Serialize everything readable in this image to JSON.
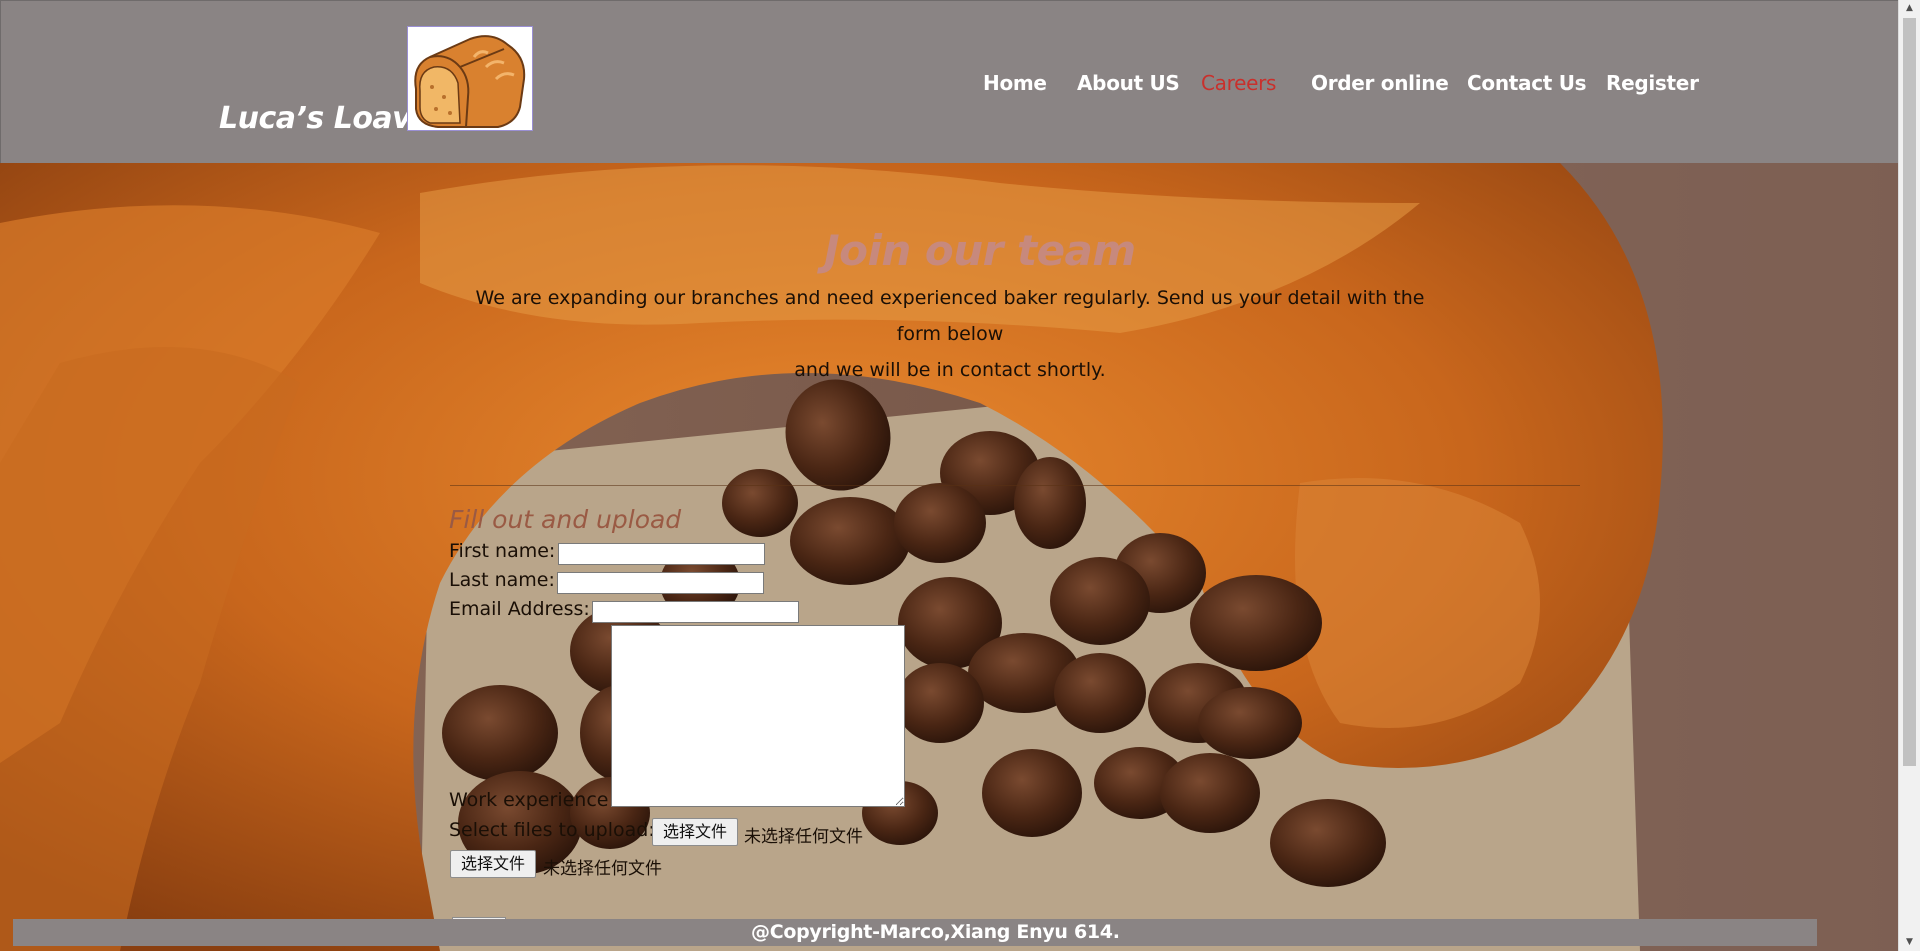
{
  "header": {
    "brand": "Luca’s Loaves",
    "logo_icon": "bread-loaf-icon",
    "nav": [
      {
        "label": "Home",
        "active": false
      },
      {
        "label": "About US",
        "active": false
      },
      {
        "label": "Careers",
        "active": true
      },
      {
        "label": "Order online",
        "active": false
      },
      {
        "label": "Contact Us",
        "active": false
      },
      {
        "label": "Register",
        "active": false
      }
    ]
  },
  "main": {
    "title": "Join our team",
    "intro_line1": "We are expanding our branches and need experienced baker regularly. Send us your detail with the form below",
    "intro_line2": "and we will be in contact shortly.",
    "form": {
      "title": "Fill out and upload",
      "first_name_label": "First name:",
      "first_name_value": "",
      "last_name_label": "Last name:",
      "last_name_value": "",
      "email_label": "Email Address:",
      "email_value": "",
      "work_experience_label": "Work experience",
      "work_experience_value": "",
      "files_label": "Select files to upload:",
      "file_button_1": "选择文件",
      "file_status_1": "未选择任何文件",
      "file_button_2": "选择文件",
      "file_status_2": "未选择任何文件"
    }
  },
  "footer": {
    "text": "@Copyright-Marco,Xiang Enyu 614."
  },
  "colors": {
    "header_bg": "#8a8484",
    "nav_active": "#c9302c",
    "title_color": "#c58a86",
    "form_title_color": "#9a5a44"
  },
  "background_image": "croissant-and-coffee-beans-photo"
}
